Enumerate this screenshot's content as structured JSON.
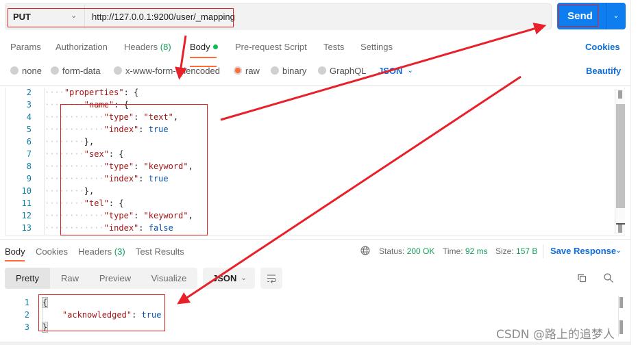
{
  "request": {
    "method": "PUT",
    "url": "http://127.0.0.1:9200/user/_mapping",
    "send_label": "Send"
  },
  "request_tabs": [
    {
      "label": "Params"
    },
    {
      "label": "Authorization"
    },
    {
      "label": "Headers",
      "count": "(8)"
    },
    {
      "label": "Body",
      "active": true,
      "indicator": "green-dot"
    },
    {
      "label": "Pre-request Script"
    },
    {
      "label": "Tests"
    },
    {
      "label": "Settings"
    }
  ],
  "cookies_link": "Cookies",
  "body_types": [
    {
      "label": "none",
      "selected": false
    },
    {
      "label": "form-data",
      "selected": false
    },
    {
      "label": "x-www-form-urlencoded",
      "selected": false
    },
    {
      "label": "raw",
      "selected": true
    },
    {
      "label": "binary",
      "selected": false
    },
    {
      "label": "GraphQL",
      "selected": false
    }
  ],
  "body_format": "JSON",
  "beautify_link": "Beautify",
  "editor": {
    "lines": [
      {
        "n": "2",
        "indent": 4,
        "tokens": [
          {
            "t": "\"properties\"",
            "c": "k"
          },
          {
            "t": ": {",
            "c": "p"
          }
        ]
      },
      {
        "n": "3",
        "indent": 8,
        "tokens": [
          {
            "t": "\"name\"",
            "c": "k"
          },
          {
            "t": ": {",
            "c": "p"
          }
        ]
      },
      {
        "n": "4",
        "indent": 12,
        "tokens": [
          {
            "t": "\"type\"",
            "c": "k"
          },
          {
            "t": ": ",
            "c": "p"
          },
          {
            "t": "\"text\"",
            "c": "s"
          },
          {
            "t": ",",
            "c": "p"
          }
        ]
      },
      {
        "n": "5",
        "indent": 12,
        "tokens": [
          {
            "t": "\"index\"",
            "c": "k"
          },
          {
            "t": ": ",
            "c": "p"
          },
          {
            "t": "true",
            "c": "b"
          }
        ]
      },
      {
        "n": "6",
        "indent": 8,
        "tokens": [
          {
            "t": "},",
            "c": "p"
          }
        ]
      },
      {
        "n": "7",
        "indent": 8,
        "tokens": [
          {
            "t": "\"sex\"",
            "c": "k"
          },
          {
            "t": ": {",
            "c": "p"
          }
        ]
      },
      {
        "n": "8",
        "indent": 12,
        "tokens": [
          {
            "t": "\"type\"",
            "c": "k"
          },
          {
            "t": ": ",
            "c": "p"
          },
          {
            "t": "\"keyword\"",
            "c": "s"
          },
          {
            "t": ",",
            "c": "p"
          }
        ]
      },
      {
        "n": "9",
        "indent": 12,
        "tokens": [
          {
            "t": "\"index\"",
            "c": "k"
          },
          {
            "t": ": ",
            "c": "p"
          },
          {
            "t": "true",
            "c": "b"
          }
        ]
      },
      {
        "n": "10",
        "indent": 8,
        "tokens": [
          {
            "t": "},",
            "c": "p"
          }
        ]
      },
      {
        "n": "11",
        "indent": 8,
        "tokens": [
          {
            "t": "\"tel\"",
            "c": "k"
          },
          {
            "t": ": {",
            "c": "p"
          }
        ]
      },
      {
        "n": "12",
        "indent": 12,
        "tokens": [
          {
            "t": "\"type\"",
            "c": "k"
          },
          {
            "t": ": ",
            "c": "p"
          },
          {
            "t": "\"keyword\"",
            "c": "s"
          },
          {
            "t": ",",
            "c": "p"
          }
        ]
      },
      {
        "n": "13",
        "indent": 12,
        "tokens": [
          {
            "t": "\"index\"",
            "c": "k"
          },
          {
            "t": ": ",
            "c": "p"
          },
          {
            "t": "false",
            "c": "b"
          }
        ]
      }
    ]
  },
  "response_tabs": [
    {
      "label": "Body",
      "active": true
    },
    {
      "label": "Cookies"
    },
    {
      "label": "Headers",
      "count": "(3)"
    },
    {
      "label": "Test Results"
    }
  ],
  "response_status": {
    "status_label": "Status:",
    "status_value": "200 OK",
    "time_label": "Time:",
    "time_value": "92 ms",
    "size_label": "Size:",
    "size_value": "157 B"
  },
  "save_response_label": "Save Response",
  "view_modes": [
    {
      "label": "Pretty",
      "active": true
    },
    {
      "label": "Raw"
    },
    {
      "label": "Preview"
    },
    {
      "label": "Visualize"
    }
  ],
  "response_format": "JSON",
  "response_body": {
    "lines": [
      {
        "n": "1",
        "tokens": [
          {
            "t": "{",
            "c": "p",
            "hl": true
          }
        ]
      },
      {
        "n": "2",
        "tokens": [
          {
            "t": "    ",
            "c": "p"
          },
          {
            "t": "\"acknowledged\"",
            "c": "k"
          },
          {
            "t": ": ",
            "c": "p"
          },
          {
            "t": "true",
            "c": "b"
          }
        ]
      },
      {
        "n": "3",
        "tokens": [
          {
            "t": "}",
            "c": "p",
            "hl": true
          }
        ]
      }
    ]
  },
  "watermark": "CSDN @路上的追梦人",
  "colors": {
    "accent": "#ff6c37",
    "send_button": "#0d7df0",
    "link_blue": "#0d6ed8",
    "status_green": "#0f9d58",
    "annotation_red": "#e02020"
  }
}
